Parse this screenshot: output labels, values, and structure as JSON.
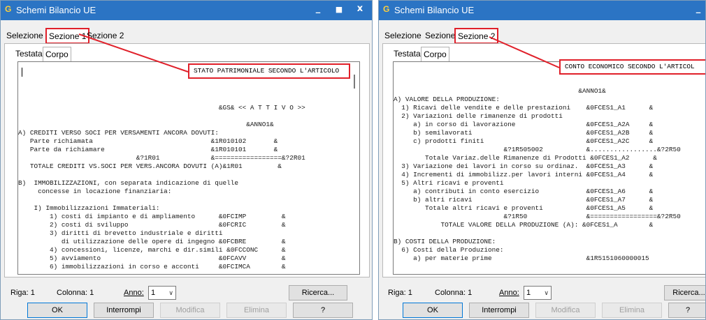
{
  "colors": {
    "titlebar": "#2b74c4",
    "highlight": "#e0202a",
    "window_bg": "#f0f0f0"
  },
  "left": {
    "app_icon": "G",
    "title": "Schemi Bilancio UE",
    "window_buttons": {
      "minimize": "_",
      "maximize": "■",
      "close": "x"
    },
    "main_tabs": [
      "Selezione",
      "Sezione 1",
      "Sezione 2"
    ],
    "sub_tabs": [
      "Testata",
      "Corpo"
    ],
    "callout": "STATO PATRIMONIALE SECONDO L'ARTICOLO",
    "code_lines": [
      "",
      "",
      "",
      "",
      "",
      "                                                   &GS& << A T T I V O >>",
      "",
      "                                                          &ANNO1&",
      "A) CREDITI VERSO SOCI PER VERSAMENTI ANCORA DOVUTI:",
      "   Parte richiamata                              &1R010102       &",
      "   Parte da richiamare                           &1R010101       &",
      "                              &?1R01             &=================&?2R01",
      "   TOTALE CREDITI VS.SOCI PER VERS.ANCORA DOVUTI (A)&1R01         &",
      "",
      "B)  IMMOBILIZZAZIONI, con separata indicazione di quelle",
      "     concesse in locazione finanziaria:",
      "",
      "    I) Immobilizzazioni Immateriali:",
      "        1) costi di impianto e di ampliamento      &0FCIMP         &",
      "        2) costi di sviluppo                       &0FCRIC         &",
      "        3) diritti di brevetto industriale e diritti",
      "           di utilizzazione delle opere di ingegno &0FCBRE         &",
      "        4) concessioni, licenze, marchi e dir.simili &0FCCONC      &",
      "        5) avviamento                              &0FCAVV         &",
      "        6) immobilizzazioni in corso e acconti     &0FCIMCA        &"
    ],
    "status": {
      "riga_label": "Riga:",
      "riga_value": "1",
      "colonna_label": "Colonna:",
      "colonna_value": "1",
      "anno_label": "Anno:",
      "anno_value": "1"
    },
    "ricerca": "Ricerca...",
    "buttons": [
      "OK",
      "Interrompi",
      "Modifica",
      "Elimina",
      "?"
    ]
  },
  "right": {
    "app_icon": "G",
    "title": "Schemi Bilancio UE",
    "window_buttons": {
      "minimize": "_"
    },
    "main_tabs": [
      "Selezione",
      "Sezione 1",
      "Sezione 2"
    ],
    "sub_tabs": [
      "Testata",
      "Corpo"
    ],
    "callout": "CONTO ECONOMICO SECONDO L'ARTICOL",
    "code_lines": [
      "",
      "",
      "",
      "                                               &ANNO1&",
      "A) VALORE DELLA PRODUZIONE:",
      "  1) Ricavi delle vendite e delle prestazioni    &0FCES1_A1      &",
      "  2) Variazioni delle rimanenze di prodotti",
      "     a) in corso di lavorazione                  &0FCES1_A2A     &",
      "     b) semilavorati                             &0FCES1_A2B     &",
      "     c) prodotti finiti                          &0FCES1_A2C     &",
      "                            &?1R505002           &.................&?2R50",
      "        Totale Variaz.delle Rimanenze di Prodotti &0FCES1_A2      &",
      "  3) Variazione dei lavori in corso su ordinaz.  &0FCES1_A3      &",
      "  4) Incrementi di immobilizz.per lavori interni &0FCES1_A4      &",
      "  5) Altri ricavi e proventi",
      "     a) contributi in conto esercizio            &0FCES1_A6      &",
      "     b) altri ricavi                             &0FCES1_A7      &",
      "        Totale altri ricavi e proventi           &0FCES1_A5      &",
      "                            &?1R50               &=================&?2R50",
      "            TOTALE VALORE DELLA PRODUZIONE (A): &0FCES1_A        &",
      "",
      "B) COSTI DELLA PRODUZIONE:",
      "  6) Costi della Produzione:",
      "     a) per materie prime                        &1R5151060000015"
    ],
    "status": {
      "riga_label": "Riga:",
      "riga_value": "1",
      "colonna_label": "Colonna:",
      "colonna_value": "1",
      "anno_label": "Anno:",
      "anno_value": "1"
    },
    "ricerca": "Ricerca...",
    "buttons": [
      "OK",
      "Interrompi",
      "Modifica",
      "Elimina",
      "?"
    ]
  }
}
